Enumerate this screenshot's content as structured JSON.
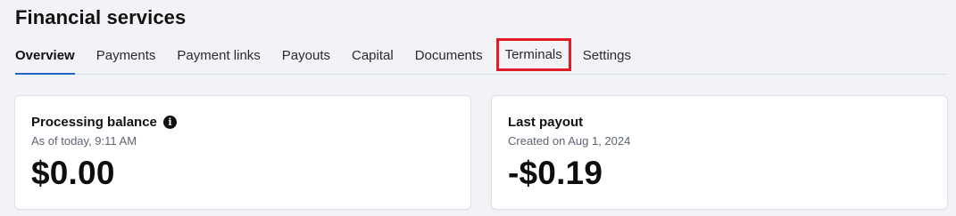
{
  "header": {
    "title": "Financial services"
  },
  "tabs": [
    {
      "label": "Overview",
      "active": true
    },
    {
      "label": "Payments",
      "active": false
    },
    {
      "label": "Payment links",
      "active": false
    },
    {
      "label": "Payouts",
      "active": false
    },
    {
      "label": "Capital",
      "active": false
    },
    {
      "label": "Documents",
      "active": false
    },
    {
      "label": "Terminals",
      "active": false,
      "highlighted": true
    },
    {
      "label": "Settings",
      "active": false
    }
  ],
  "cards": {
    "processing_balance": {
      "title": "Processing balance",
      "icon": "info-icon",
      "subtitle": "As of today, 9:11 AM",
      "amount": "$0.00"
    },
    "last_payout": {
      "title": "Last payout",
      "subtitle": "Created on Aug 1, 2024",
      "amount": "-$0.19"
    }
  },
  "colors": {
    "background": "#f1f3f6",
    "active_tab_underline": "#2563c9",
    "highlight_box": "#e01b24"
  }
}
